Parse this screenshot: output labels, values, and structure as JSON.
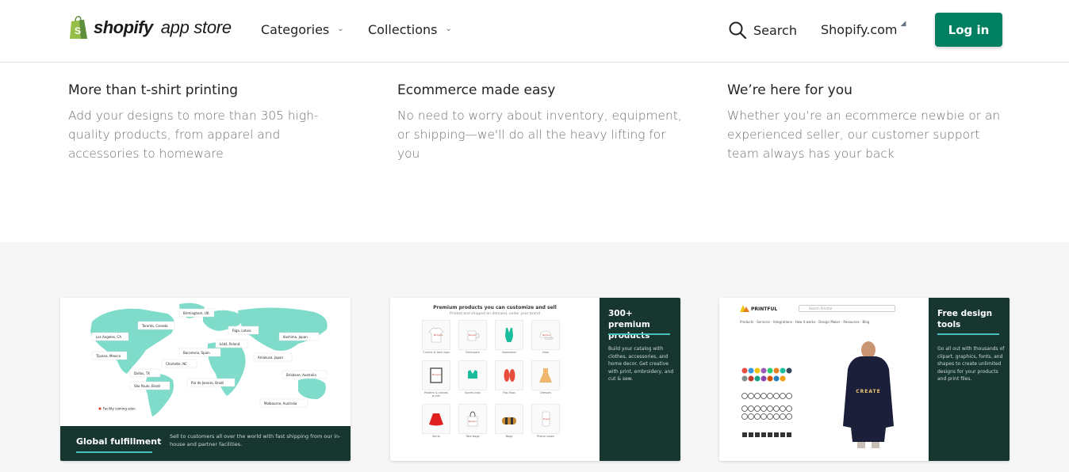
{
  "header": {
    "logo_word": "shopify",
    "logo_sub": "app store",
    "nav": {
      "categories": "Categories",
      "collections": "Collections"
    },
    "search_label": "Search",
    "shopify_link": "Shopify.com",
    "login_label": "Log in"
  },
  "features": [
    {
      "title": "More than t-shirt printing",
      "body": "Add your designs to more than 305 high-quality products, from apparel and accessories to homeware"
    },
    {
      "title": "Ecommerce made easy",
      "body": "No need to worry about inventory, equipment, or shipping—we'll do all the heavy lifting for you"
    },
    {
      "title": "We’re here for you",
      "body": "Whether you’re an ecommerce newbie or an experienced seller, our customer support team always has your back"
    }
  ],
  "gallery": {
    "card1": {
      "title": "Global fulfillment",
      "desc": "Sell to customers all over the world with fast shipping from our in-house and partner facilities.",
      "cities": [
        "Birmingham, UK",
        "Toronto, Canada",
        "Riga, Latvia",
        "Los Angeles, CA",
        "Łódź, Poland",
        "Kashima, Japan",
        "Tijuana, Mexico",
        "Barcelona, Spain",
        "Charlotte, NC",
        "Amakusa, Japan",
        "Dallas, TX",
        "Brisbane, Australia",
        "Rio de Janeiro, Brazil",
        "São Paulo, Brazil",
        "Melbourne, Australia"
      ],
      "legend": "Facility coming soon"
    },
    "card2": {
      "heading": "Premium products you can customize and sell",
      "subheading": "Printed and shipped on demand, under your brand",
      "panel_title": "300+ premium products",
      "panel_desc": "Build your catalog with clothes, accessories, and home decor. Get creative with print, embroidery, and cut & sew.",
      "products": [
        "T-shirts & tank tops",
        "Drinkware",
        "Swimwear",
        "Hats",
        "Posters & canvas prints",
        "Sports bras",
        "Flip-flops",
        "Dresses",
        "Skirts",
        "Tote bags",
        "Bags",
        "Phone cases"
      ]
    },
    "card3": {
      "brand": "PRINTFUL",
      "search_placeholder": "Search Printful",
      "menu": "Products  ·  Services  ·  Integrations  ·  How it works  ·  Design Maker  ·  Resources  ·  Blog",
      "hoodie_text": "CREATE",
      "panel_title": "Free design tools",
      "panel_desc": "Go all out with thousands of clipart, graphics, fonts, and shapes to create unlimited designs for your products and print files."
    }
  },
  "colors": {
    "brand_green": "#008060",
    "dark_teal": "#173630",
    "accent_teal": "#47c1bf",
    "map_land": "#7fdccb"
  }
}
